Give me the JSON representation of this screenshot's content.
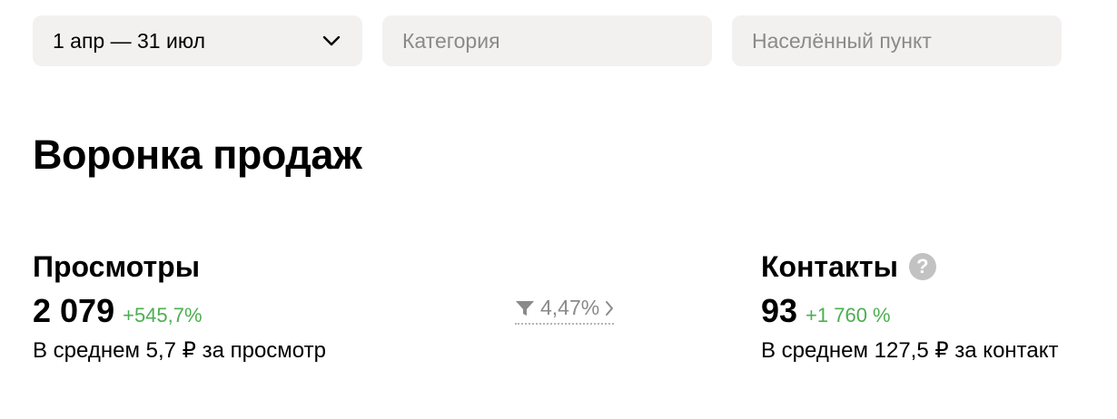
{
  "filters": {
    "date_range": "1 апр — 31 июл",
    "category_placeholder": "Категория",
    "location_placeholder": "Населённый пункт"
  },
  "page_title": "Воронка продаж",
  "views": {
    "title": "Просмотры",
    "value": "2 079",
    "delta": "+545,7%",
    "average": "В среднем 5,7 ₽ за просмотр"
  },
  "conversion": {
    "value": "4,47%"
  },
  "contacts": {
    "title": "Контакты",
    "help_icon": "?",
    "value": "93",
    "delta": "+1 760 %",
    "average": "В среднем 127,5 ₽ за контакт"
  },
  "colors": {
    "positive_delta": "#4caf50",
    "filter_bg": "#f2f1f0",
    "muted_text": "#8a8a8a"
  },
  "icons": {
    "date_dropdown": "chevron-down-icon",
    "conversion": "funnel-icon",
    "conversion_more": "chevron-right-icon",
    "contacts_help": "question-icon"
  }
}
